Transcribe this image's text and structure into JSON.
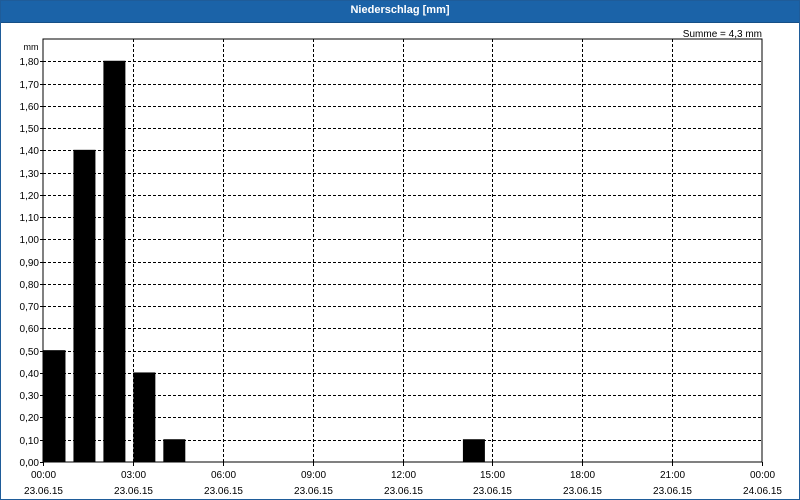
{
  "window": {
    "title": "Niederschlag [mm]"
  },
  "chart_data": {
    "type": "bar",
    "title": "Niederschlag [mm]",
    "ylabel": "mm",
    "annotation": "Summe = 4,3 mm",
    "ylim": [
      0,
      1.9
    ],
    "y_ticks": [
      "0,00",
      "0,10",
      "0,20",
      "0,30",
      "0,40",
      "0,50",
      "0,60",
      "0,70",
      "0,80",
      "0,90",
      "1,00",
      "1,10",
      "1,20",
      "1,30",
      "1,40",
      "1,50",
      "1,60",
      "1,70",
      "1,80"
    ],
    "x_range_hours": [
      0,
      24
    ],
    "x_ticks": [
      {
        "time": "00:00",
        "date": "23.06.15"
      },
      {
        "time": "03:00",
        "date": "23.06.15"
      },
      {
        "time": "06:00",
        "date": "23.06.15"
      },
      {
        "time": "09:00",
        "date": "23.06.15"
      },
      {
        "time": "12:00",
        "date": "23.06.15"
      },
      {
        "time": "15:00",
        "date": "23.06.15"
      },
      {
        "time": "18:00",
        "date": "23.06.15"
      },
      {
        "time": "21:00",
        "date": "23.06.15"
      },
      {
        "time": "00:00",
        "date": "24.06.15"
      }
    ],
    "bars": [
      {
        "time": "00:00",
        "value": 0.5
      },
      {
        "time": "01:00",
        "value": 1.4
      },
      {
        "time": "02:00",
        "value": 1.8
      },
      {
        "time": "03:00",
        "value": 0.4
      },
      {
        "time": "04:00",
        "value": 0.1
      },
      {
        "time": "14:00",
        "value": 0.1
      }
    ],
    "grid": true,
    "bar_color": "#000000"
  }
}
